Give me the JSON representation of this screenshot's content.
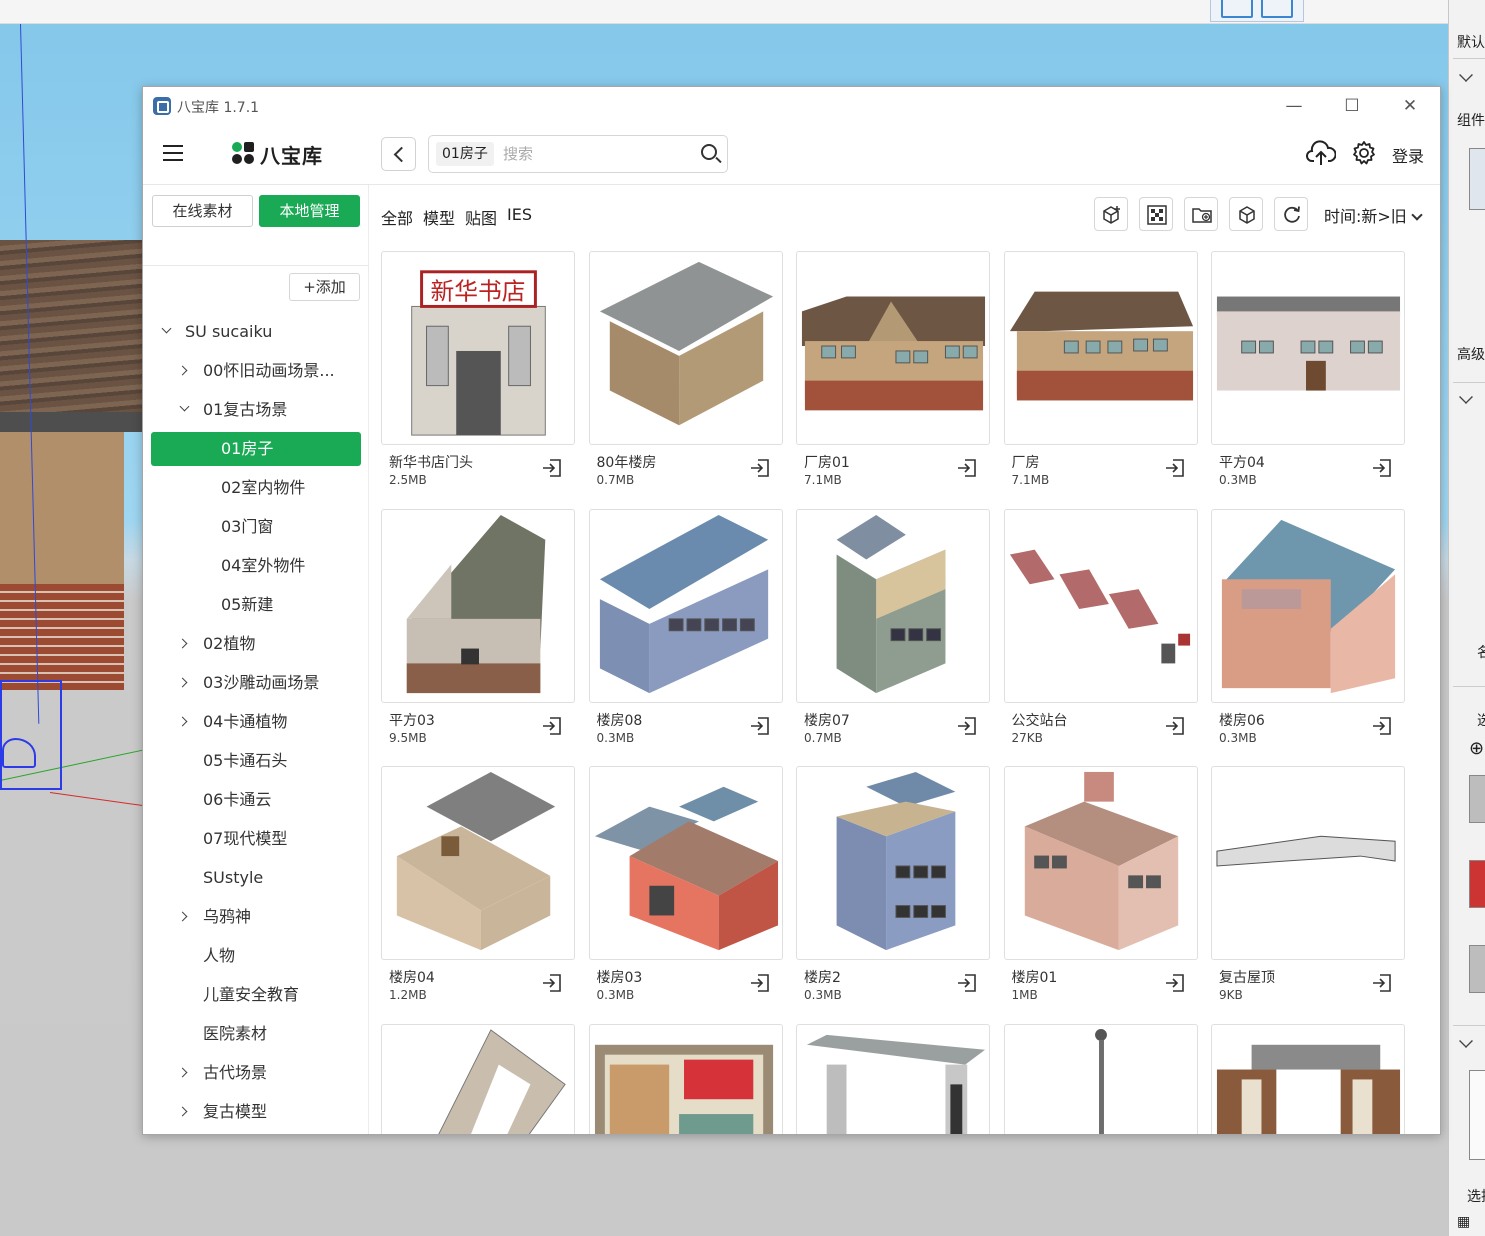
{
  "window": {
    "title": "八宝库 1.7.1",
    "minimize": "—",
    "maximize": "☐",
    "close": "✕"
  },
  "header": {
    "logo_text": "八宝库",
    "search_tag": "01房子",
    "search_placeholder": "搜索",
    "login": "登录"
  },
  "sidebar": {
    "online_label": "在线素材",
    "local_label": "本地管理",
    "add_label": "+添加",
    "tree": [
      {
        "label": "SU sucaiku",
        "level": 0,
        "caret": "down"
      },
      {
        "label": "00怀旧动画场景...",
        "level": 1,
        "caret": "right"
      },
      {
        "label": "01复古场景",
        "level": 1,
        "caret": "down"
      },
      {
        "label": "01房子",
        "level": 2,
        "caret": "",
        "active": true
      },
      {
        "label": "02室内物件",
        "level": 2,
        "caret": ""
      },
      {
        "label": "03门窗",
        "level": 2,
        "caret": ""
      },
      {
        "label": "04室外物件",
        "level": 2,
        "caret": ""
      },
      {
        "label": "05新建",
        "level": 2,
        "caret": ""
      },
      {
        "label": "02植物",
        "level": 1,
        "caret": "right"
      },
      {
        "label": "03沙雕动画场景",
        "level": 1,
        "caret": "right"
      },
      {
        "label": "04卡通植物",
        "level": 1,
        "caret": "right"
      },
      {
        "label": "05卡通石头",
        "level": 1,
        "caret": ""
      },
      {
        "label": "06卡通云",
        "level": 1,
        "caret": ""
      },
      {
        "label": "07现代模型",
        "level": 1,
        "caret": ""
      },
      {
        "label": "SUstyle",
        "level": 1,
        "caret": ""
      },
      {
        "label": "乌鸦神",
        "level": 1,
        "caret": "right"
      },
      {
        "label": "人物",
        "level": 1,
        "caret": ""
      },
      {
        "label": "儿童安全教育",
        "level": 1,
        "caret": ""
      },
      {
        "label": "医院素材",
        "level": 1,
        "caret": ""
      },
      {
        "label": "古代场景",
        "level": 1,
        "caret": "right"
      },
      {
        "label": "复古模型",
        "level": 1,
        "caret": "right"
      }
    ]
  },
  "main": {
    "tabs": [
      {
        "label": "全部",
        "active": true
      },
      {
        "label": "模型",
        "active": false
      },
      {
        "label": "贴图",
        "active": false
      },
      {
        "label": "IES",
        "active": false
      }
    ],
    "sort_label": "时间:新>旧",
    "items": [
      {
        "name": "新华书店门头",
        "size": "2.5MB",
        "thumb": "storefront"
      },
      {
        "name": "80年楼房",
        "size": "0.7MB",
        "thumb": "flat-roof-house"
      },
      {
        "name": "厂房01",
        "size": "7.1MB",
        "thumb": "gable-house"
      },
      {
        "name": "厂房",
        "size": "7.1MB",
        "thumb": "long-gable-house"
      },
      {
        "name": "平方04",
        "size": "0.3MB",
        "thumb": "flat-house-white"
      },
      {
        "name": "平方03",
        "size": "9.5MB",
        "thumb": "old-gable-house"
      },
      {
        "name": "楼房08",
        "size": "0.3MB",
        "thumb": "blue-building"
      },
      {
        "name": "楼房07",
        "size": "0.7MB",
        "thumb": "grey-tower"
      },
      {
        "name": "公交站台",
        "size": "27KB",
        "thumb": "bus-stop"
      },
      {
        "name": "楼房06",
        "size": "0.3MB",
        "thumb": "pink-building"
      },
      {
        "name": "楼房04",
        "size": "1.2MB",
        "thumb": "rooftop-solar"
      },
      {
        "name": "楼房03",
        "size": "0.3MB",
        "thumb": "red-shop"
      },
      {
        "name": "楼房2",
        "size": "0.3MB",
        "thumb": "blue-tower"
      },
      {
        "name": "楼房01",
        "size": "1MB",
        "thumb": "pink-tower"
      },
      {
        "name": "复古屋顶",
        "size": "9KB",
        "thumb": "roof-slab"
      },
      {
        "name": "",
        "size": "",
        "thumb": "frame-slab"
      },
      {
        "name": "",
        "size": "",
        "thumb": "poster-wall"
      },
      {
        "name": "",
        "size": "",
        "thumb": "gate"
      },
      {
        "name": "",
        "size": "",
        "thumb": "street-lamp"
      },
      {
        "name": "",
        "size": "",
        "thumb": "arch-gate"
      }
    ]
  },
  "tray": {
    "labels": [
      "默认",
      "组件",
      "高级",
      "名",
      "选",
      "选择"
    ]
  },
  "colors": {
    "accent": "#1aaa55"
  }
}
